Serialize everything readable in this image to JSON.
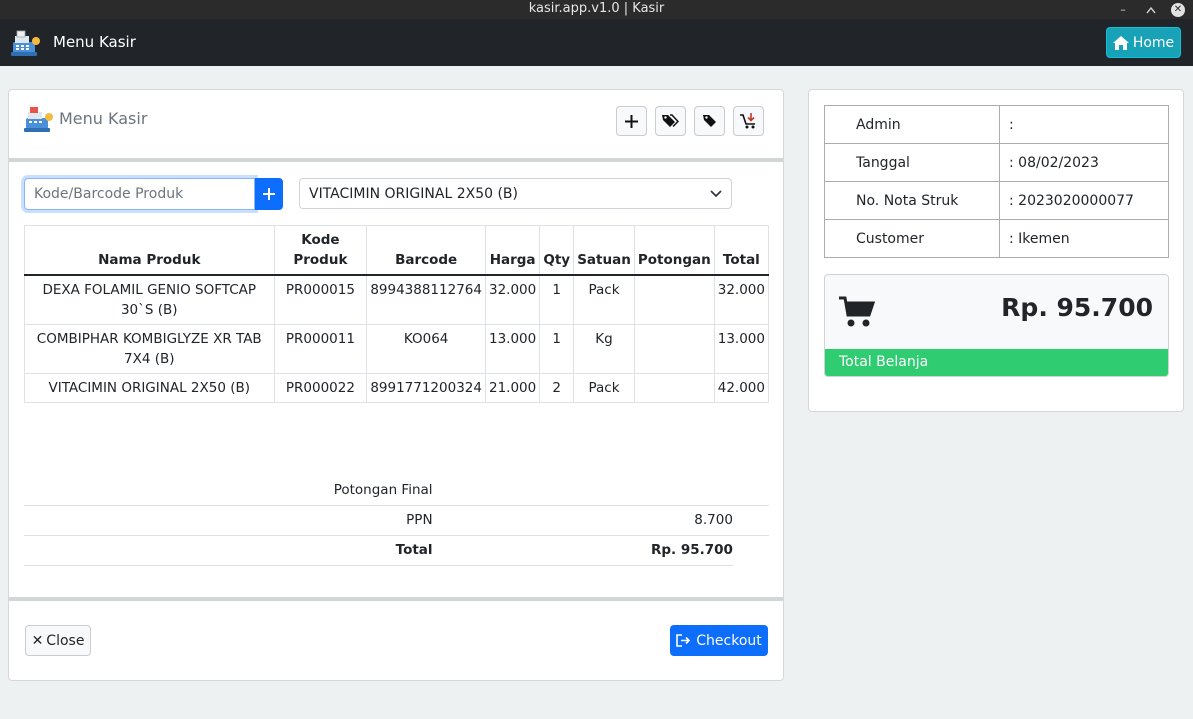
{
  "window": {
    "title": "kasir.app.v1.0 | Kasir"
  },
  "navbar": {
    "title": "Menu Kasir",
    "home_label": "Home"
  },
  "card": {
    "title": "Menu Kasir"
  },
  "toolbar": {
    "icons": [
      "plus-icon",
      "tags-icon",
      "tag-icon",
      "cart-arrow-down-icon"
    ]
  },
  "search": {
    "placeholder": "Kode/Barcode Produk",
    "value": ""
  },
  "product_select": {
    "selected": "VITACIMIN ORIGINAL 2X50 (B)"
  },
  "table": {
    "headers": [
      "Nama Produk",
      "Kode Produk",
      "Barcode",
      "Harga",
      "Qty",
      "Satuan",
      "Potongan",
      "Total"
    ],
    "rows": [
      {
        "nama": "DEXA FOLAMIL GENIO SOFTCAP 30`S (B)",
        "kode": "PR000015",
        "barcode": "8994388112764",
        "harga": "32.000",
        "qty": "1",
        "satuan": "Pack",
        "potongan": "",
        "total": "32.000"
      },
      {
        "nama": "COMBIPHAR KOMBIGLYZE XR TAB 7X4 (B)",
        "kode": "PR000011",
        "barcode": "KO064",
        "harga": "13.000",
        "qty": "1",
        "satuan": "Kg",
        "potongan": "",
        "total": "13.000"
      },
      {
        "nama": "VITACIMIN ORIGINAL 2X50 (B)",
        "kode": "PR000022",
        "barcode": "8991771200324",
        "harga": "21.000",
        "qty": "2",
        "satuan": "Pack",
        "potongan": "",
        "total": "42.000"
      }
    ]
  },
  "summary": {
    "potongan_label": "Potongan Final",
    "potongan_value": "",
    "ppn_label": "PPN",
    "ppn_value": "8.700",
    "total_label": "Total",
    "total_value": "Rp. 95.700"
  },
  "actions": {
    "close_label": "Close",
    "checkout_label": "Checkout"
  },
  "info": {
    "admin_label": "Admin",
    "admin_value": ":",
    "tanggal_label": "Tanggal",
    "tanggal_value": ": 08/02/2023",
    "nota_label": "No. Nota Struk",
    "nota_value": ": 2023020000077",
    "customer_label": "Customer",
    "customer_value": ": Ikemen"
  },
  "total_box": {
    "amount": "Rp. 95.700",
    "caption": "Total Belanja"
  },
  "colors": {
    "navbar": "#212529",
    "home_button": "#17a2b8",
    "primary": "#0d6efd",
    "total_caption_bg": "#2fcc71"
  }
}
